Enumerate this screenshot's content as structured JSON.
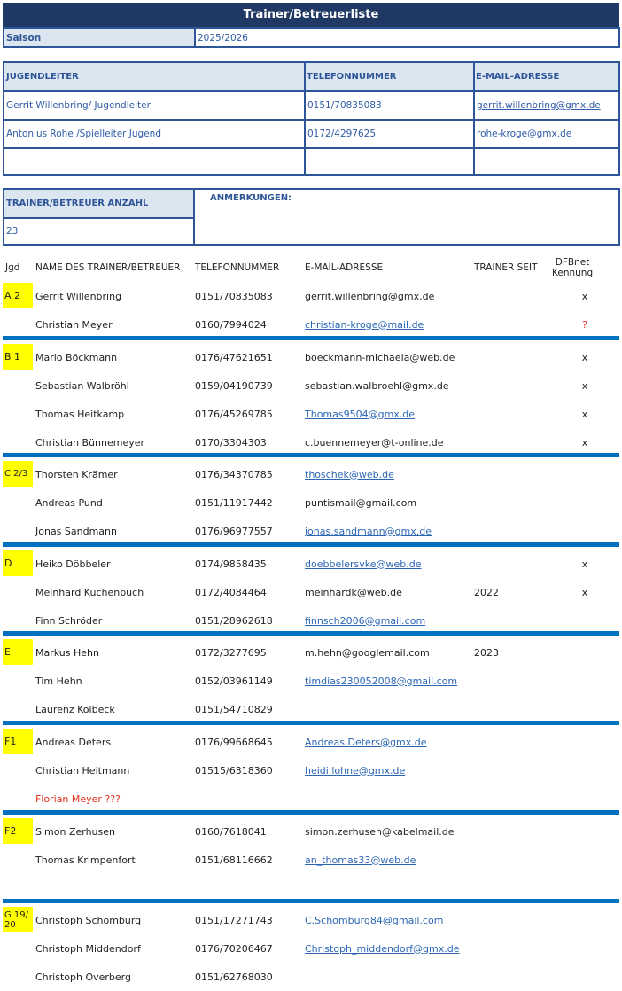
{
  "title": "Trainer/Betreuerliste",
  "saison": {
    "label": "Saison",
    "value": "2025/2026"
  },
  "leaders": {
    "headers": [
      "JUGENDLEITER",
      "TELEFONNUMMER",
      "E-MAIL-ADRESSE"
    ],
    "rows": [
      {
        "name": "Gerrit Willenbring/ Jugendleiter",
        "phone": "0151/70835083",
        "email": "gerrit.willenbring@gmx.de"
      },
      {
        "name": "Antonius Rohe /Spielleiter Jugend",
        "phone": "0172/4297625",
        "email": "rohe-kroge@gmx.de"
      }
    ]
  },
  "count": {
    "label": "TRAINER/BETREUER ANZAHL",
    "value": "23"
  },
  "notes": {
    "label": "ANMERKUNGEN:"
  },
  "list_headers": {
    "jgd": "Jgd",
    "name": "NAME DES TRAINER/BETREUER",
    "phone": "TELEFONNUMMER",
    "email": "E-MAIL-ADRESSE",
    "since": "TRAINER SEIT",
    "dfb_line1": "DFBnet",
    "dfb_line2": "Kennung"
  },
  "groups": [
    {
      "team": "A 2",
      "people": [
        {
          "name": "Gerrit Willenbring",
          "phone": "0151/70835083",
          "email": "gerrit.willenbring@gmx.de",
          "link": false,
          "since": "",
          "dfb": "x"
        },
        {
          "name": "Christian Meyer",
          "phone": "0160/7994024",
          "email": "christian-kroge@mail.de",
          "link": true,
          "since": "",
          "dfb": "?"
        }
      ]
    },
    {
      "team": "B 1",
      "people": [
        {
          "name": "Mario Böckmann",
          "phone": "0176/47621651",
          "email": "boeckmann-michaela@web.de",
          "link": false,
          "since": "",
          "dfb": "x"
        },
        {
          "name": "Sebastian Walbröhl",
          "phone": "0159/04190739",
          "email": "sebastian.walbroehl@gmx.de",
          "link": false,
          "since": "",
          "dfb": "x"
        },
        {
          "name": "Thomas Heitkamp",
          "phone": "0176/45269785",
          "email": "Thomas9504@gmx.de",
          "link": true,
          "since": "",
          "dfb": "x"
        },
        {
          "name": "Christian Bünnemeyer",
          "phone": "0170/3304303",
          "email": "c.buennemeyer@t-online.de",
          "link": false,
          "since": "",
          "dfb": "x"
        }
      ]
    },
    {
      "team": "C 2/3",
      "people": [
        {
          "name": "Thorsten Krämer",
          "phone": "0176/34370785",
          "email": "thoschek@web.de",
          "link": true,
          "since": "",
          "dfb": ""
        },
        {
          "name": "Andreas Pund",
          "phone": "0151/11917442",
          "email": "puntismail@gmail.com",
          "link": false,
          "since": "",
          "dfb": ""
        },
        {
          "name": "Jonas Sandmann",
          "phone": "0176/96977557",
          "email": "jonas.sandmann@gmx.de",
          "link": true,
          "since": "",
          "dfb": ""
        }
      ]
    },
    {
      "team": "D",
      "people": [
        {
          "name": "Heiko Döbbeler",
          "phone": "0174/9858435",
          "email": "doebbelersvke@web.de",
          "link": true,
          "since": "",
          "dfb": "x"
        },
        {
          "name": "Meinhard Kuchenbuch",
          "phone": "0172/4084464",
          "email": "meinhardk@web.de",
          "link": false,
          "since": "2022",
          "dfb": "x"
        },
        {
          "name": "Finn Schröder",
          "phone": "0151/28962618",
          "email": "finnsch2006@gmail.com",
          "link": true,
          "since": "",
          "dfb": ""
        }
      ]
    },
    {
      "team": "E",
      "people": [
        {
          "name": "Markus Hehn",
          "phone": "0172/3277695",
          "email": "m.hehn@googlemail.com",
          "link": false,
          "since": "2023",
          "dfb": ""
        },
        {
          "name": "Tim Hehn",
          "phone": "0152/03961149",
          "email": "timdias230052008@gmail.com",
          "link": true,
          "since": "",
          "dfb": ""
        },
        {
          "name": "Laurenz Kolbeck",
          "phone": "0151/54710829",
          "email": "",
          "link": false,
          "since": "",
          "dfb": ""
        }
      ]
    },
    {
      "team": "F1",
      "people": [
        {
          "name": "Andreas Deters",
          "phone": "0176/99668645",
          "email": "Andreas.Deters@gmx.de",
          "link": true,
          "since": "",
          "dfb": ""
        },
        {
          "name": "Christian Heitmann",
          "phone": "01515/6318360",
          "email": "heidi.lohne@gmx.de",
          "link": true,
          "since": "",
          "dfb": ""
        },
        {
          "name": "Florian Meyer ???",
          "phone": "",
          "email": "",
          "link": false,
          "since": "",
          "dfb": "",
          "red": true
        }
      ]
    },
    {
      "team": "F2",
      "people": [
        {
          "name": "Simon Zerhusen",
          "phone": "0160/7618041",
          "email": "simon.zerhusen@kabelmail.de",
          "link": false,
          "since": "",
          "dfb": ""
        },
        {
          "name": "Thomas Krimpenfort",
          "phone": "0151/68116662",
          "email": "an_thomas33@web.de",
          "link": true,
          "since": "",
          "dfb": ""
        },
        {
          "name": "",
          "phone": "",
          "email": "",
          "link": false,
          "since": "",
          "dfb": ""
        }
      ]
    },
    {
      "team": "G 19/20",
      "people": [
        {
          "name": "Christoph Schomburg",
          "phone": "0151/17271743",
          "email": "C.Schomburg84@gmail.com",
          "link": true,
          "since": "",
          "dfb": ""
        },
        {
          "name": "Christoph Middendorf",
          "phone": "0176/70206467",
          "email": "Christoph_middendorf@gmx.de",
          "link": true,
          "since": "",
          "dfb": ""
        },
        {
          "name": "Christoph Overberg",
          "phone": "0151/62768030",
          "email": "",
          "link": false,
          "since": "",
          "dfb": ""
        }
      ]
    }
  ]
}
